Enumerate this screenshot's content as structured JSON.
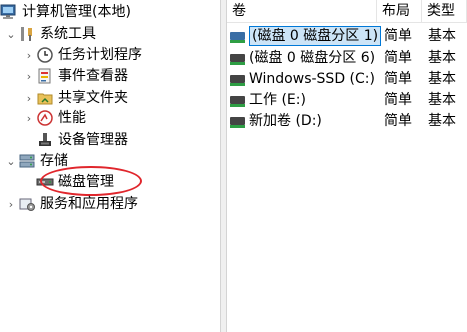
{
  "tree": {
    "root": "计算机管理(本地)",
    "system_tools": "系统工具",
    "task_scheduler": "任务计划程序",
    "event_viewer": "事件查看器",
    "shared_folders": "共享文件夹",
    "performance": "性能",
    "device_manager": "设备管理器",
    "storage": "存储",
    "disk_management": "磁盘管理",
    "services_apps": "服务和应用程序"
  },
  "list": {
    "headers": {
      "volume": "卷",
      "layout": "布局",
      "type": "类型"
    },
    "rows": [
      {
        "volume": "(磁盘 0 磁盘分区 1)",
        "layout": "简单",
        "type": "基本"
      },
      {
        "volume": "(磁盘 0 磁盘分区 6)",
        "layout": "简单",
        "type": "基本"
      },
      {
        "volume": "Windows-SSD (C:)",
        "layout": "简单",
        "type": "基本"
      },
      {
        "volume": "工作 (E:)",
        "layout": "简单",
        "type": "基本"
      },
      {
        "volume": "新加卷 (D:)",
        "layout": "简单",
        "type": "基本"
      }
    ]
  },
  "colors": {
    "selection_bg": "#cce4f7",
    "selection_border": "#0078d7",
    "annotation_circle": "#e0262c"
  }
}
